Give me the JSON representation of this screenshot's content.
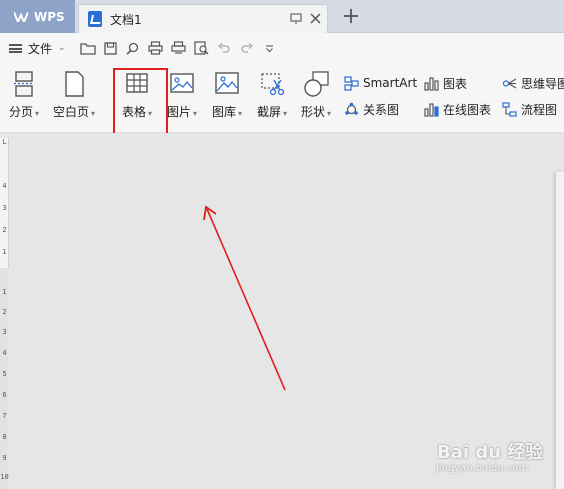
{
  "app": {
    "name": "WPS",
    "doc_tab_title": "文档1"
  },
  "quick_toolbar": {
    "file_label": "文件"
  },
  "ribbon": {
    "large": [
      {
        "label": "分页",
        "dropdown": true,
        "icon": "page-break-icon"
      },
      {
        "label": "空白页",
        "dropdown": true,
        "icon": "blank-page-icon"
      },
      {
        "label": "表格",
        "dropdown": true,
        "icon": "table-icon"
      },
      {
        "label": "图片",
        "dropdown": true,
        "icon": "picture-icon"
      },
      {
        "label": "图库",
        "dropdown": true,
        "icon": "gallery-icon"
      },
      {
        "label": "截屏",
        "dropdown": true,
        "icon": "screenshot-icon"
      },
      {
        "label": "形状",
        "dropdown": true,
        "icon": "shape-icon"
      }
    ],
    "small": [
      {
        "label": "SmartArt",
        "icon": "smartart-icon"
      },
      {
        "label": "关系图",
        "icon": "relation-icon"
      },
      {
        "label": "图表",
        "icon": "chart-icon"
      },
      {
        "label": "在线图表",
        "icon": "online-chart-icon"
      },
      {
        "label": "思维导图",
        "icon": "mindmap-icon"
      },
      {
        "label": "流程图",
        "icon": "flowchart-icon"
      }
    ]
  },
  "ruler_numbers": [
    "L",
    "4",
    "3",
    "2",
    "1",
    "1",
    "2",
    "3",
    "4",
    "5",
    "6",
    "7",
    "8",
    "9",
    "10"
  ],
  "watermark": {
    "text": "Bai du 经验",
    "url": "jingyan.baidu.com"
  },
  "colors": {
    "wps_tab": "#8ea3c8",
    "highlight": "#e0201f",
    "arrow": "#e0201f"
  }
}
